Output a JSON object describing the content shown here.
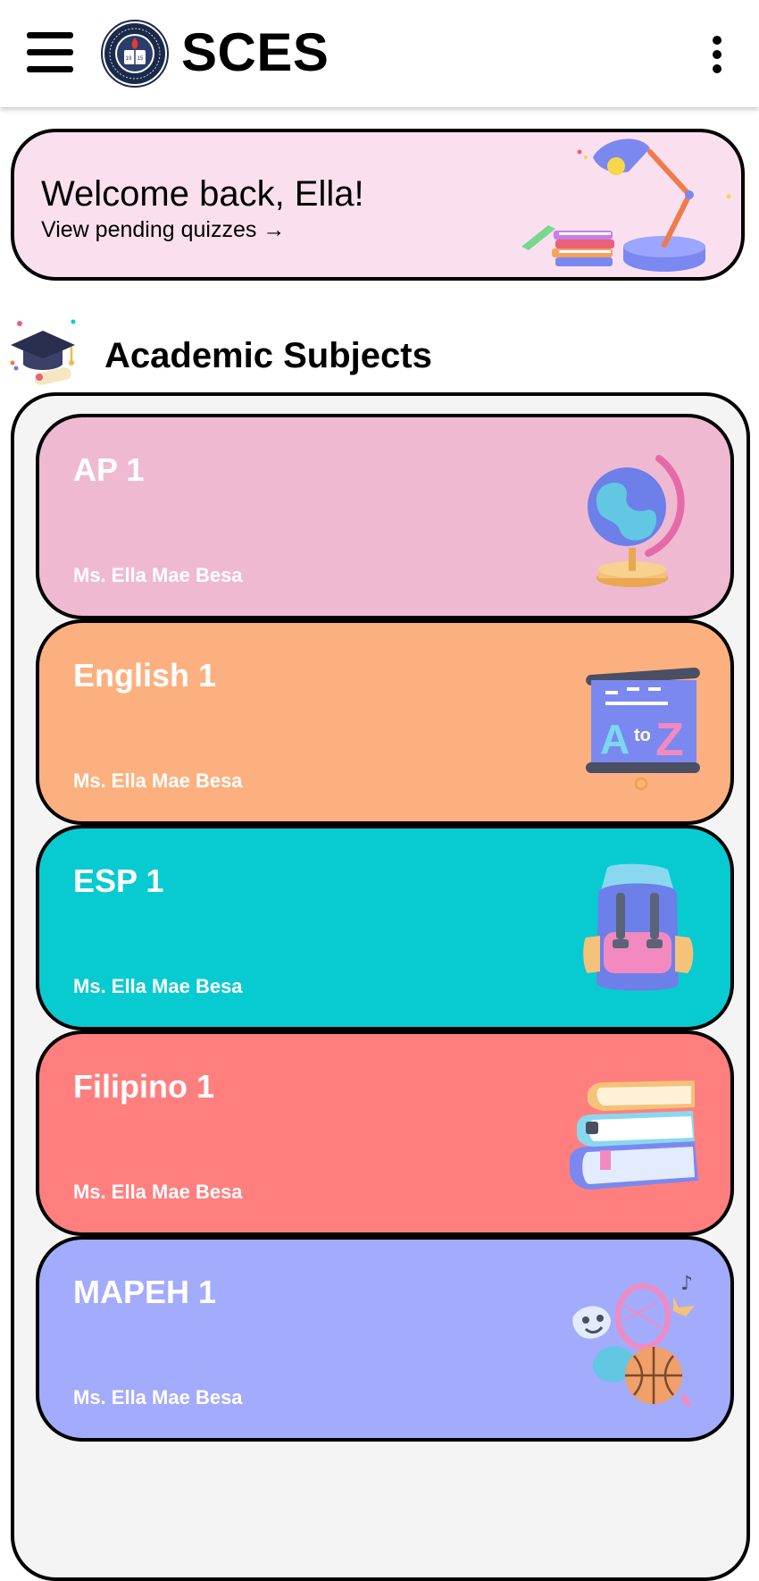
{
  "header": {
    "brand": "SCES",
    "menu_icon": "hamburger-menu-icon",
    "more_icon": "vertical-dots-icon"
  },
  "welcome": {
    "title": "Welcome back, Ella!",
    "link": "View pending quizzes",
    "link_arrow": "→",
    "background": "#fae0ef"
  },
  "section": {
    "title": "Academic Subjects"
  },
  "subjects": [
    {
      "name": "AP 1",
      "teacher": "Ms. Ella Mae Besa",
      "color": "#efb9d2",
      "icon": "globe-icon"
    },
    {
      "name": "English 1",
      "teacher": "Ms. Ella Mae Besa",
      "color": "#fdb07f",
      "icon": "a-to-z-board-icon"
    },
    {
      "name": "ESP 1",
      "teacher": "Ms. Ella Mae Besa",
      "color": "#08cbd1",
      "icon": "backpack-icon"
    },
    {
      "name": "Filipino 1",
      "teacher": "Ms. Ella Mae Besa",
      "color": "#ff7f7f",
      "icon": "book-stack-icon"
    },
    {
      "name": "MAPEH 1",
      "teacher": "Ms. Ella Mae Besa",
      "color": "#a3abfd",
      "icon": "arts-sports-icon"
    }
  ]
}
